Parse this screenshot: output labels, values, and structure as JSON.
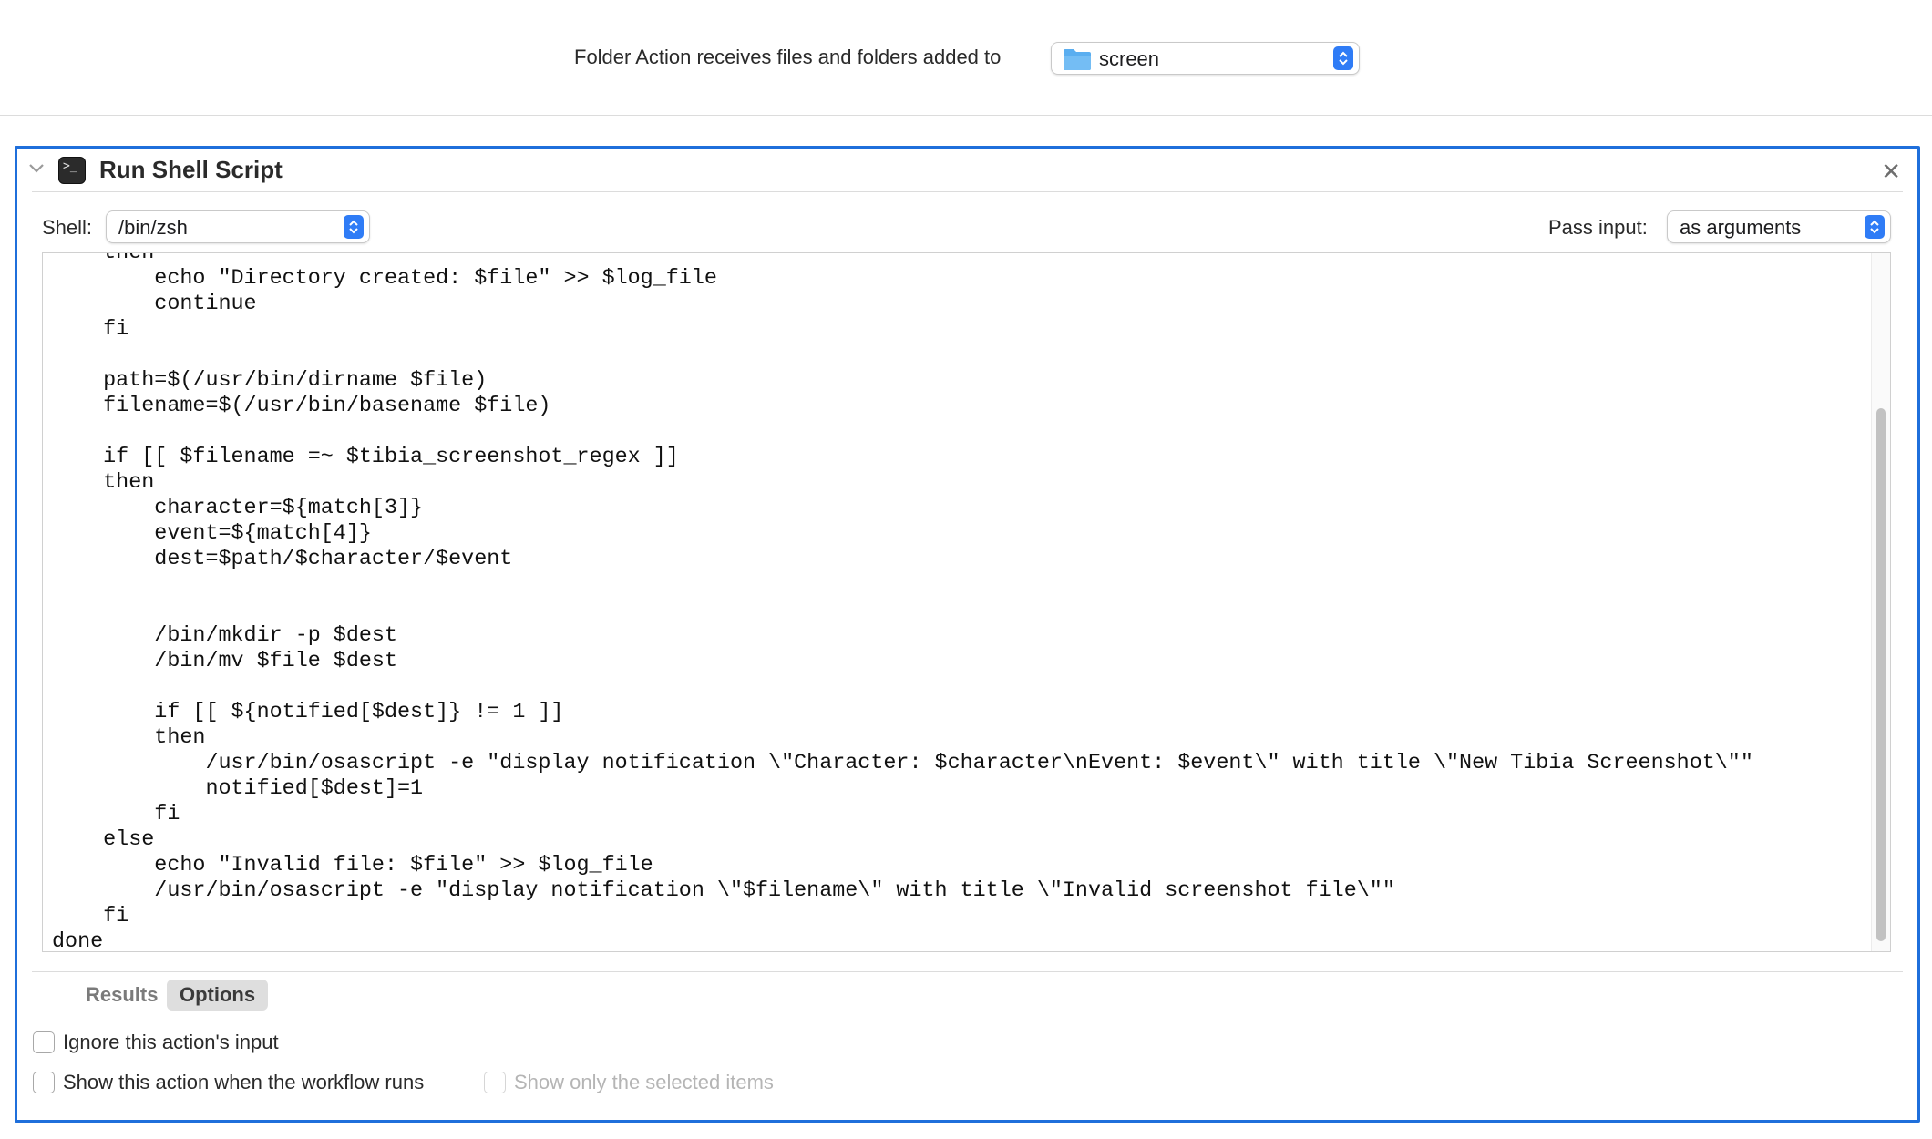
{
  "header": {
    "label": "Folder Action receives files and folders added to",
    "folder_value": "screen"
  },
  "action": {
    "title": "Run Shell Script",
    "shell_label": "Shell:",
    "shell_value": "/bin/zsh",
    "pass_input_label": "Pass input:",
    "pass_input_value": "as arguments",
    "script": "    then\n        echo \"Directory created: $file\" >> $log_file\n        continue\n    fi\n\n    path=$(/usr/bin/dirname $file)\n    filename=$(/usr/bin/basename $file)\n\n    if [[ $filename =~ $tibia_screenshot_regex ]]\n    then\n        character=${match[3]}\n        event=${match[4]}\n        dest=$path/$character/$event\n\n\n        /bin/mkdir -p $dest\n        /bin/mv $file $dest\n\n        if [[ ${notified[$dest]} != 1 ]]\n        then\n            /usr/bin/osascript -e \"display notification \\\"Character: $character\\nEvent: $event\\\" with title \\\"New Tibia Screenshot\\\"\"\n            notified[$dest]=1\n        fi\n    else\n        echo \"Invalid file: $file\" >> $log_file\n        /usr/bin/osascript -e \"display notification \\\"$filename\\\" with title \\\"Invalid screenshot file\\\"\"\n    fi\ndone"
  },
  "tabs": [
    {
      "label": "Results",
      "selected": false
    },
    {
      "label": "Options",
      "selected": true
    }
  ],
  "options": {
    "ignore_input_label": "Ignore this action's input",
    "show_action_label": "Show this action when the workflow runs",
    "show_selected_label": "Show only the selected items"
  },
  "colors": {
    "accent": "#1f6fdb",
    "stepper": "#2f7cf6",
    "folder": "#5aaef0"
  }
}
